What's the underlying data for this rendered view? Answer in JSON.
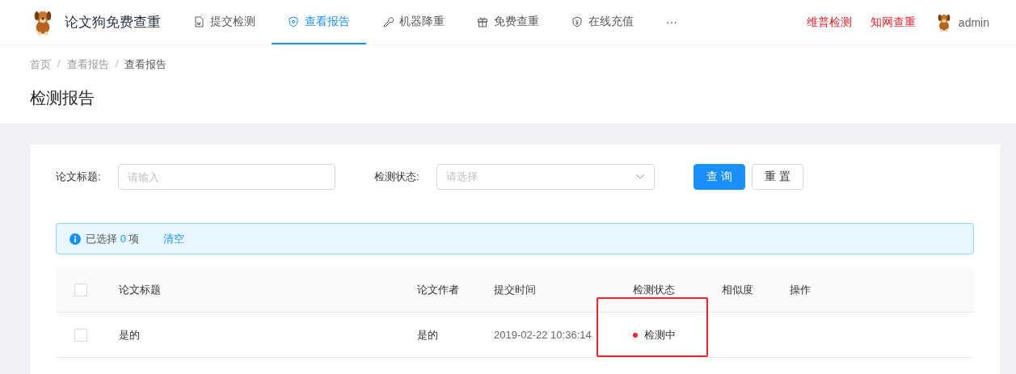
{
  "brand": {
    "title": "论文狗免费查重"
  },
  "nav": [
    {
      "label": "提交检测",
      "selected": false
    },
    {
      "label": "查看报告",
      "selected": true
    },
    {
      "label": "机器降重",
      "selected": false
    },
    {
      "label": "免费查重",
      "selected": false
    },
    {
      "label": "在线充值",
      "selected": false
    },
    {
      "label": "···",
      "selected": false
    }
  ],
  "header_links": [
    "维普检测",
    "知网查重"
  ],
  "user": {
    "name": "admin"
  },
  "breadcrumb": [
    {
      "label": "首页"
    },
    {
      "separator": "/",
      "label": "查看报告"
    },
    {
      "separator": "/",
      "label": "查看报告"
    }
  ],
  "page_title": "检测报告",
  "filters": [
    {
      "kind": "input",
      "label": "论文标题:",
      "placeholder": "请输入"
    },
    {
      "kind": "select",
      "label": "检测状态:",
      "placeholder": "请选择"
    }
  ],
  "buttons": [
    {
      "label": "查 询",
      "kind": "primary"
    },
    {
      "label": "重 置",
      "kind": "default"
    }
  ],
  "alert": {
    "prefix": "已选择",
    "count": "0",
    "suffix": "项",
    "action": "清空"
  },
  "table": {
    "select_all_checked": false,
    "columns": [
      "论文标题",
      "论文作者",
      "提交时间",
      "检测状态",
      "相似度",
      "操作"
    ],
    "rows": [
      {
        "checked": false,
        "title": "是的",
        "author": "是的",
        "time": "2019-02-22 10:36:14",
        "status": "检测中"
      }
    ]
  }
}
